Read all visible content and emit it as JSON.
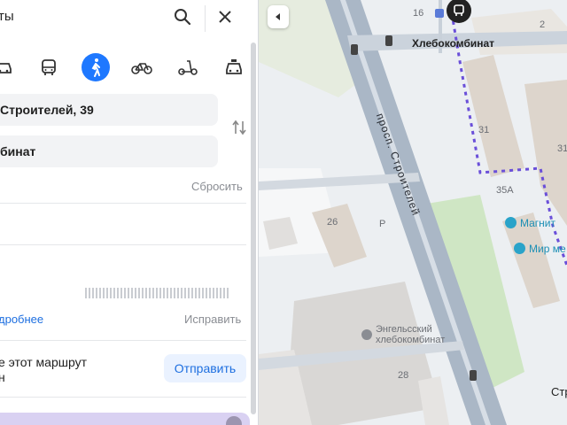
{
  "search": {
    "query_fragment": "ты"
  },
  "modes": [
    {
      "name": "car"
    },
    {
      "name": "bus"
    },
    {
      "name": "walk",
      "active": true
    },
    {
      "name": "bike"
    },
    {
      "name": "scooter"
    },
    {
      "name": "taxi"
    }
  ],
  "route": {
    "from": "Строителей, 39",
    "to": "бинат",
    "reset_label": "Сбросить"
  },
  "details": {
    "more_label": "дробнее",
    "fix_label": "Исправить"
  },
  "share": {
    "text_line1": "е этот маршрут",
    "text_line2": "н",
    "send_label": "Отправить"
  },
  "map": {
    "bus_stop_label": "Хлебокомбинат",
    "street_label": "просп. Строителей",
    "factory_label_line1": "Энгельсский",
    "factory_label_line2": "хлебокомбинат",
    "shop_magnit": "Магнит",
    "shop_mir": "Мир ме",
    "house_16": "16",
    "house_2": "2",
    "house_31": "31",
    "house_31_right": "31",
    "house_35a": "35А",
    "house_26": "26",
    "house_28": "28",
    "parking": "P",
    "cut_label": "Стр"
  },
  "colors": {
    "accent": "#1e78ff",
    "route_dotted": "#6a4fd9",
    "road": "#aab7c6",
    "green": "#cfe6c4"
  }
}
